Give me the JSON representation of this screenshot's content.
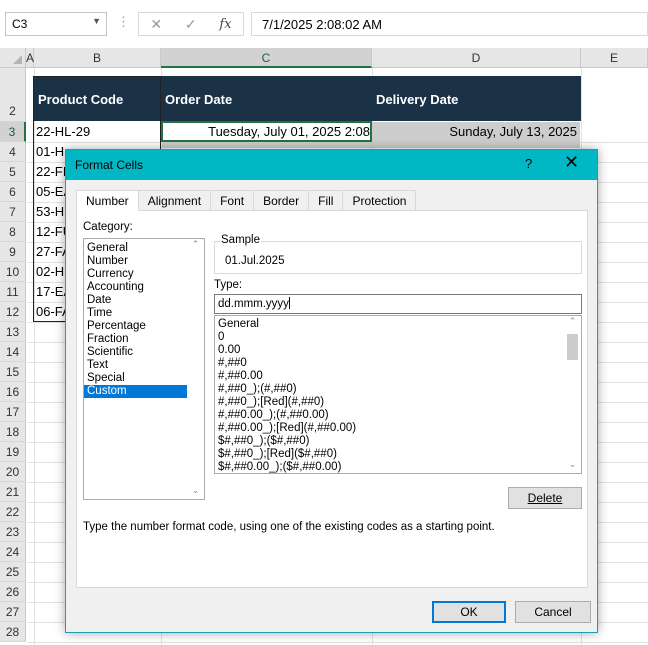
{
  "formula_bar": {
    "name_box": "C3",
    "value": "7/1/2025  2:08:02 AM",
    "cancel_icon": "✕",
    "enter_icon": "✓",
    "fx_label": "fx",
    "more_icon": "⋮"
  },
  "columns": [
    "A",
    "B",
    "C",
    "D",
    "E"
  ],
  "rows": [
    "2",
    "3",
    "4",
    "5",
    "6",
    "7",
    "8",
    "9",
    "10",
    "11",
    "12",
    "13",
    "14",
    "15",
    "16",
    "17",
    "18",
    "19",
    "20",
    "21",
    "22",
    "23",
    "24",
    "25",
    "26",
    "27",
    "28"
  ],
  "table": {
    "headers": {
      "product_code": "Product Code",
      "order_date": "Order Date",
      "delivery_date": "Delivery Date"
    },
    "product_codes": [
      "22-HL-29",
      "01-H",
      "22-FI",
      "05-EA",
      "53-H",
      "12-FU",
      "27-FA",
      "02-H",
      "17-EA",
      "06-FA"
    ],
    "order_date_row3": "Tuesday, July 01, 2025  2:08",
    "delivery_date_row3": "Sunday, July 13, 2025"
  },
  "dialog": {
    "title": "Format Cells",
    "help": "?",
    "close": "✕",
    "tabs": [
      "Number",
      "Alignment",
      "Font",
      "Border",
      "Fill",
      "Protection"
    ],
    "category_label": "Category:",
    "categories": [
      "General",
      "Number",
      "Currency",
      "Accounting",
      "Date",
      "Time",
      "Percentage",
      "Fraction",
      "Scientific",
      "Text",
      "Special",
      "Custom"
    ],
    "selected_category": "Custom",
    "sample_label": "Sample",
    "sample_value": "01.Jul.2025",
    "type_label": "Type:",
    "type_value": "dd.mmm.yyyy",
    "formats": [
      "General",
      "0",
      "0.00",
      "#,##0",
      "#,##0.00",
      "#,##0_);(#,##0)",
      "#,##0_);[Red](#,##0)",
      "#,##0.00_);(#,##0.00)",
      "#,##0.00_);[Red](#,##0.00)",
      "$#,##0_);($#,##0)",
      "$#,##0_);[Red]($#,##0)",
      "$#,##0.00_);($#,##0.00)"
    ],
    "delete_button": "Delete",
    "description": "Type the number format code, using one of the existing codes as a starting point.",
    "ok_button": "OK",
    "cancel_button": "Cancel"
  },
  "colors": {
    "header_fill": "#1b3146",
    "titlebar": "#00b7c3",
    "selection": "#0078d7",
    "excel_green": "#217346"
  }
}
